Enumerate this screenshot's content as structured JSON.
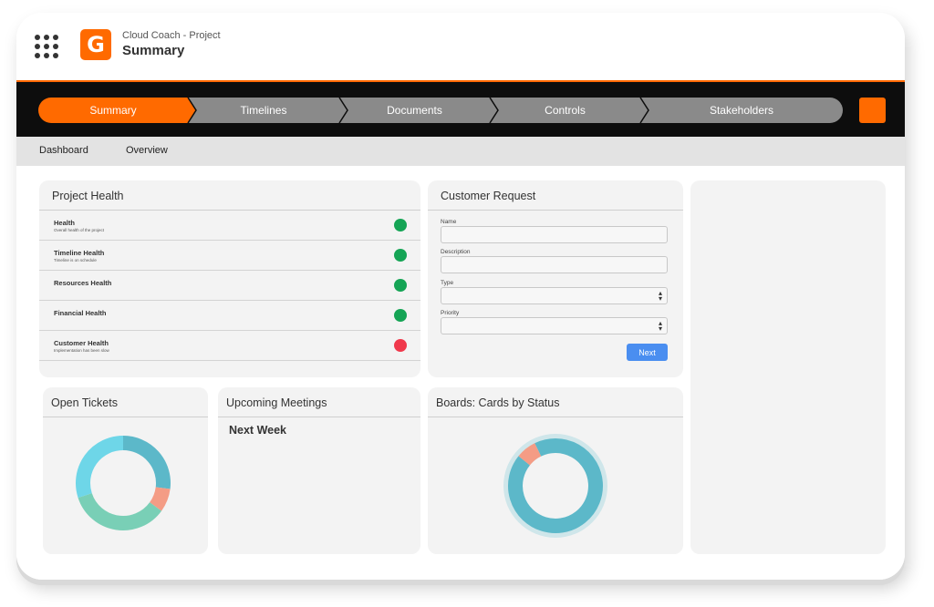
{
  "app": {
    "subtitle": "Cloud Coach - Project",
    "title": "Summary",
    "logo_letter": "G"
  },
  "colors": {
    "brand": "#ff6a00",
    "nav_bg": "#0d0d0d",
    "stage_gray": "#8a8a8a",
    "green": "#15a455",
    "red": "#f0384b",
    "button_blue": "#4a8ef0",
    "teal": "#5cb8c9",
    "cyan": "#6ed6e8",
    "mint": "#79cfb6",
    "salmon": "#f49c85"
  },
  "stages": [
    {
      "label": "Summary",
      "active": true
    },
    {
      "label": "Timelines",
      "active": false
    },
    {
      "label": "Documents",
      "active": false
    },
    {
      "label": "Controls",
      "active": false
    },
    {
      "label": "Stakeholders",
      "active": false
    }
  ],
  "subnav": [
    "Dashboard",
    "Overview"
  ],
  "project_health": {
    "title": "Project Health",
    "rows": [
      {
        "name": "Health",
        "desc": "Overall health of the project",
        "status": "green"
      },
      {
        "name": "Timeline Health",
        "desc": "Timeline is on schedule",
        "status": "green"
      },
      {
        "name": "Resources Health",
        "desc": "",
        "status": "green"
      },
      {
        "name": "Financial Health",
        "desc": "",
        "status": "green"
      },
      {
        "name": "Customer Health",
        "desc": "Implementation has been slow",
        "status": "red"
      }
    ]
  },
  "customer_request": {
    "title": "Customer Request",
    "fields": [
      {
        "label": "Name",
        "type": "text",
        "value": ""
      },
      {
        "label": "Description",
        "type": "text",
        "value": ""
      },
      {
        "label": "Type",
        "type": "select",
        "value": ""
      },
      {
        "label": "Priority",
        "type": "select",
        "value": ""
      }
    ],
    "next_label": "Next"
  },
  "open_tickets": {
    "title": "Open Tickets"
  },
  "upcoming_meetings": {
    "title": "Upcoming Meetings",
    "next_week": "Next Week"
  },
  "boards": {
    "title": "Boards: Cards by Status"
  },
  "chart_data": [
    {
      "type": "pie",
      "donut": true,
      "title": "Open Tickets",
      "slices": [
        {
          "value": 27,
          "color": "#5cb8c9"
        },
        {
          "value": 8,
          "color": "#f49c85"
        },
        {
          "value": 35,
          "color": "#79cfb6"
        },
        {
          "value": 30,
          "color": "#6ed6e8"
        }
      ]
    },
    {
      "type": "pie",
      "donut": true,
      "title": "Boards: Cards by Status",
      "slices": [
        {
          "value": 93,
          "color": "#5cb8c9"
        },
        {
          "value": 7,
          "color": "#f49c85"
        }
      ]
    }
  ]
}
